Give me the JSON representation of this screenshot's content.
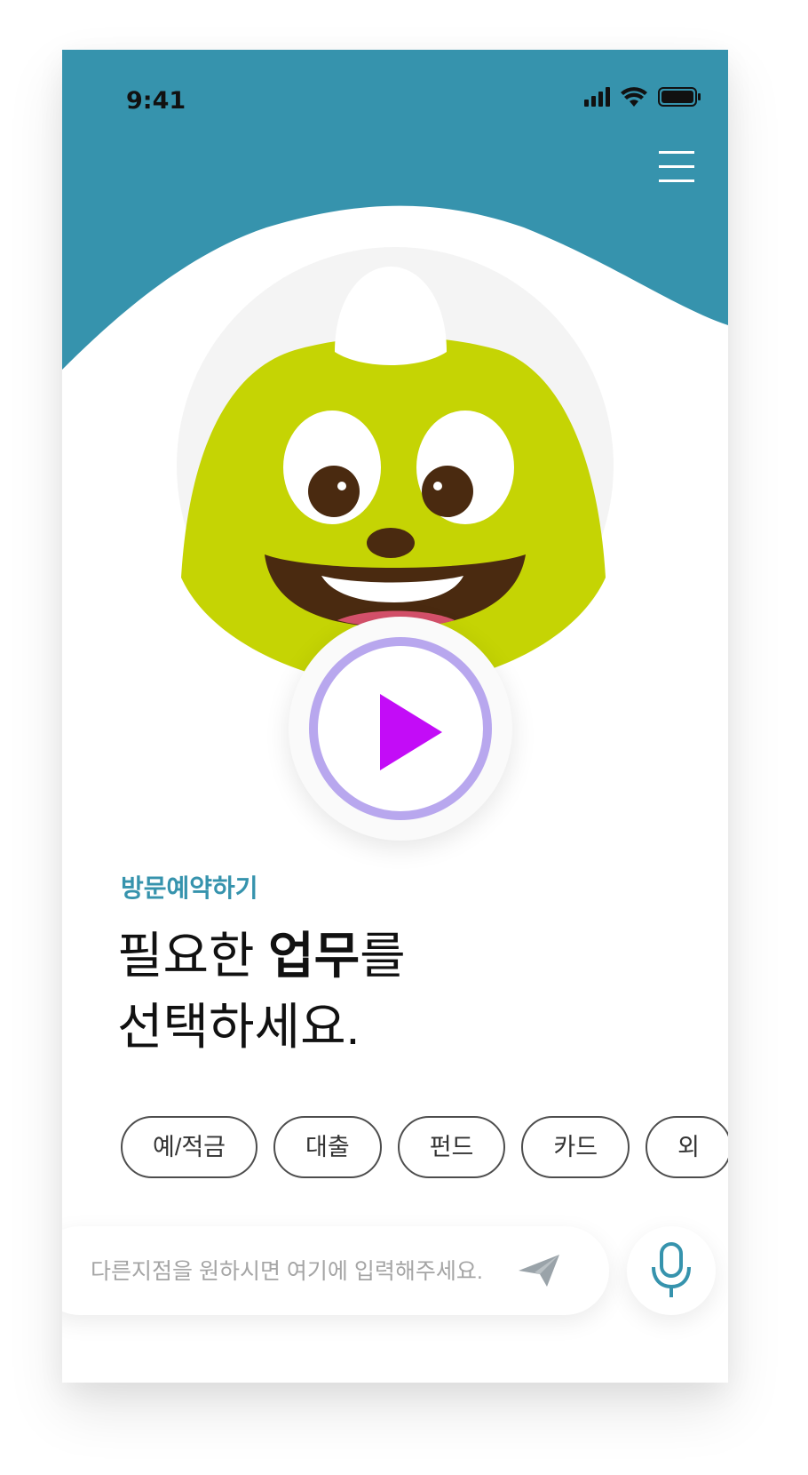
{
  "status_bar": {
    "time": "9:41",
    "icons": [
      "signal-icon",
      "wifi-icon",
      "battery-icon"
    ]
  },
  "header": {
    "menu_icon": "hamburger-menu-icon",
    "accent_color": "#3693ad"
  },
  "character": {
    "description_icon": "green-mascot-avatar",
    "colors": {
      "body": "#c5d404",
      "eyes": "#4a2a10",
      "mouth": "#4a2a10",
      "tongue": "#d6516b"
    }
  },
  "player": {
    "play_icon": "play-icon",
    "ring_color": "#b8a7ee",
    "triangle_color": "#c30cf7"
  },
  "content": {
    "subtitle": "방문예약하기",
    "headline_part1": "필요한 ",
    "headline_bold": "업무",
    "headline_part2": "를",
    "headline_line2": "선택하세요."
  },
  "chips": [
    {
      "label": "예/적금"
    },
    {
      "label": "대출"
    },
    {
      "label": "펀드"
    },
    {
      "label": "카드"
    },
    {
      "label": "외"
    }
  ],
  "input": {
    "placeholder": "다른지점을 원하시면 여기에 입력해주세요.",
    "value": "",
    "send_icon": "send-icon"
  },
  "mic": {
    "icon": "microphone-icon"
  }
}
